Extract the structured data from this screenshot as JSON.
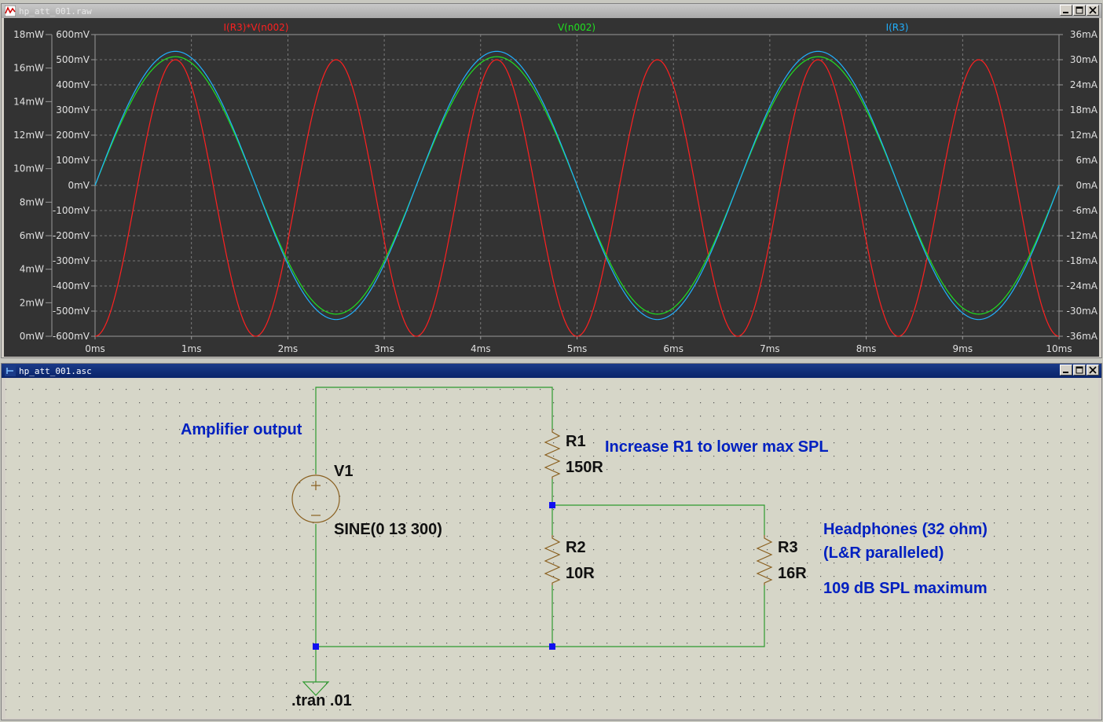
{
  "waveform_window": {
    "title": "hp_att_001.raw",
    "traces": [
      {
        "name": "I(R3)*V(n002)",
        "color": "#ff2020"
      },
      {
        "name": "V(n002)",
        "color": "#20e020"
      },
      {
        "name": "I(R3)",
        "color": "#20b0ff"
      }
    ],
    "left_outer_ticks": [
      "18mW",
      "16mW",
      "14mW",
      "12mW",
      "10mW",
      "8mW",
      "6mW",
      "4mW",
      "2mW",
      "0mW"
    ],
    "left_inner_ticks": [
      "600mV",
      "500mV",
      "400mV",
      "300mV",
      "200mV",
      "100mV",
      "0mV",
      "-100mV",
      "-200mV",
      "-300mV",
      "-400mV",
      "-500mV",
      "-600mV"
    ],
    "right_ticks": [
      "36mA",
      "30mA",
      "24mA",
      "18mA",
      "12mA",
      "6mA",
      "0mA",
      "-6mA",
      "-12mA",
      "-18mA",
      "-24mA",
      "-30mA",
      "-36mA"
    ],
    "x_ticks": [
      "0ms",
      "1ms",
      "2ms",
      "3ms",
      "4ms",
      "5ms",
      "6ms",
      "7ms",
      "8ms",
      "9ms",
      "10ms"
    ]
  },
  "schematic_window": {
    "title": "hp_att_001.asc",
    "labels": {
      "amp_output": "Amplifier output",
      "v1_name": "V1",
      "v1_value": "SINE(0 13 300)",
      "r1_name": "R1",
      "r1_value": "150R",
      "r1_note": "Increase R1 to lower max SPL",
      "r2_name": "R2",
      "r2_value": "10R",
      "r3_name": "R3",
      "r3_value": "16R",
      "hp_note1": "Headphones (32 ohm)",
      "hp_note2": "(L&R paralleled)",
      "hp_note3": "109 dB SPL maximum",
      "tran": ".tran .01"
    }
  },
  "colors": {
    "plot_bg": "#333333",
    "grid": "#8a8a8a",
    "schematic_bg": "#d6d6c8",
    "wire": "#2e9a2e",
    "component": "#8a6020",
    "comment": "#0020c0"
  },
  "chart_data": {
    "type": "line",
    "x_unit": "ms",
    "xlim": [
      0,
      10
    ],
    "series": [
      {
        "name": "I(R3)*V(n002)",
        "axis": "left_outer",
        "ylim": [
          0,
          18
        ],
        "unit": "mW",
        "waveform": "sin^2",
        "peak": 16.5,
        "frequency_hz": 300
      },
      {
        "name": "V(n002)",
        "axis": "left_inner",
        "ylim": [
          -600,
          600
        ],
        "unit": "mV",
        "waveform": "sine",
        "amplitude": 512,
        "frequency_hz": 300
      },
      {
        "name": "I(R3)",
        "axis": "right",
        "ylim": [
          -36,
          36
        ],
        "unit": "mA",
        "waveform": "sine",
        "amplitude": 32,
        "frequency_hz": 300
      }
    ]
  }
}
